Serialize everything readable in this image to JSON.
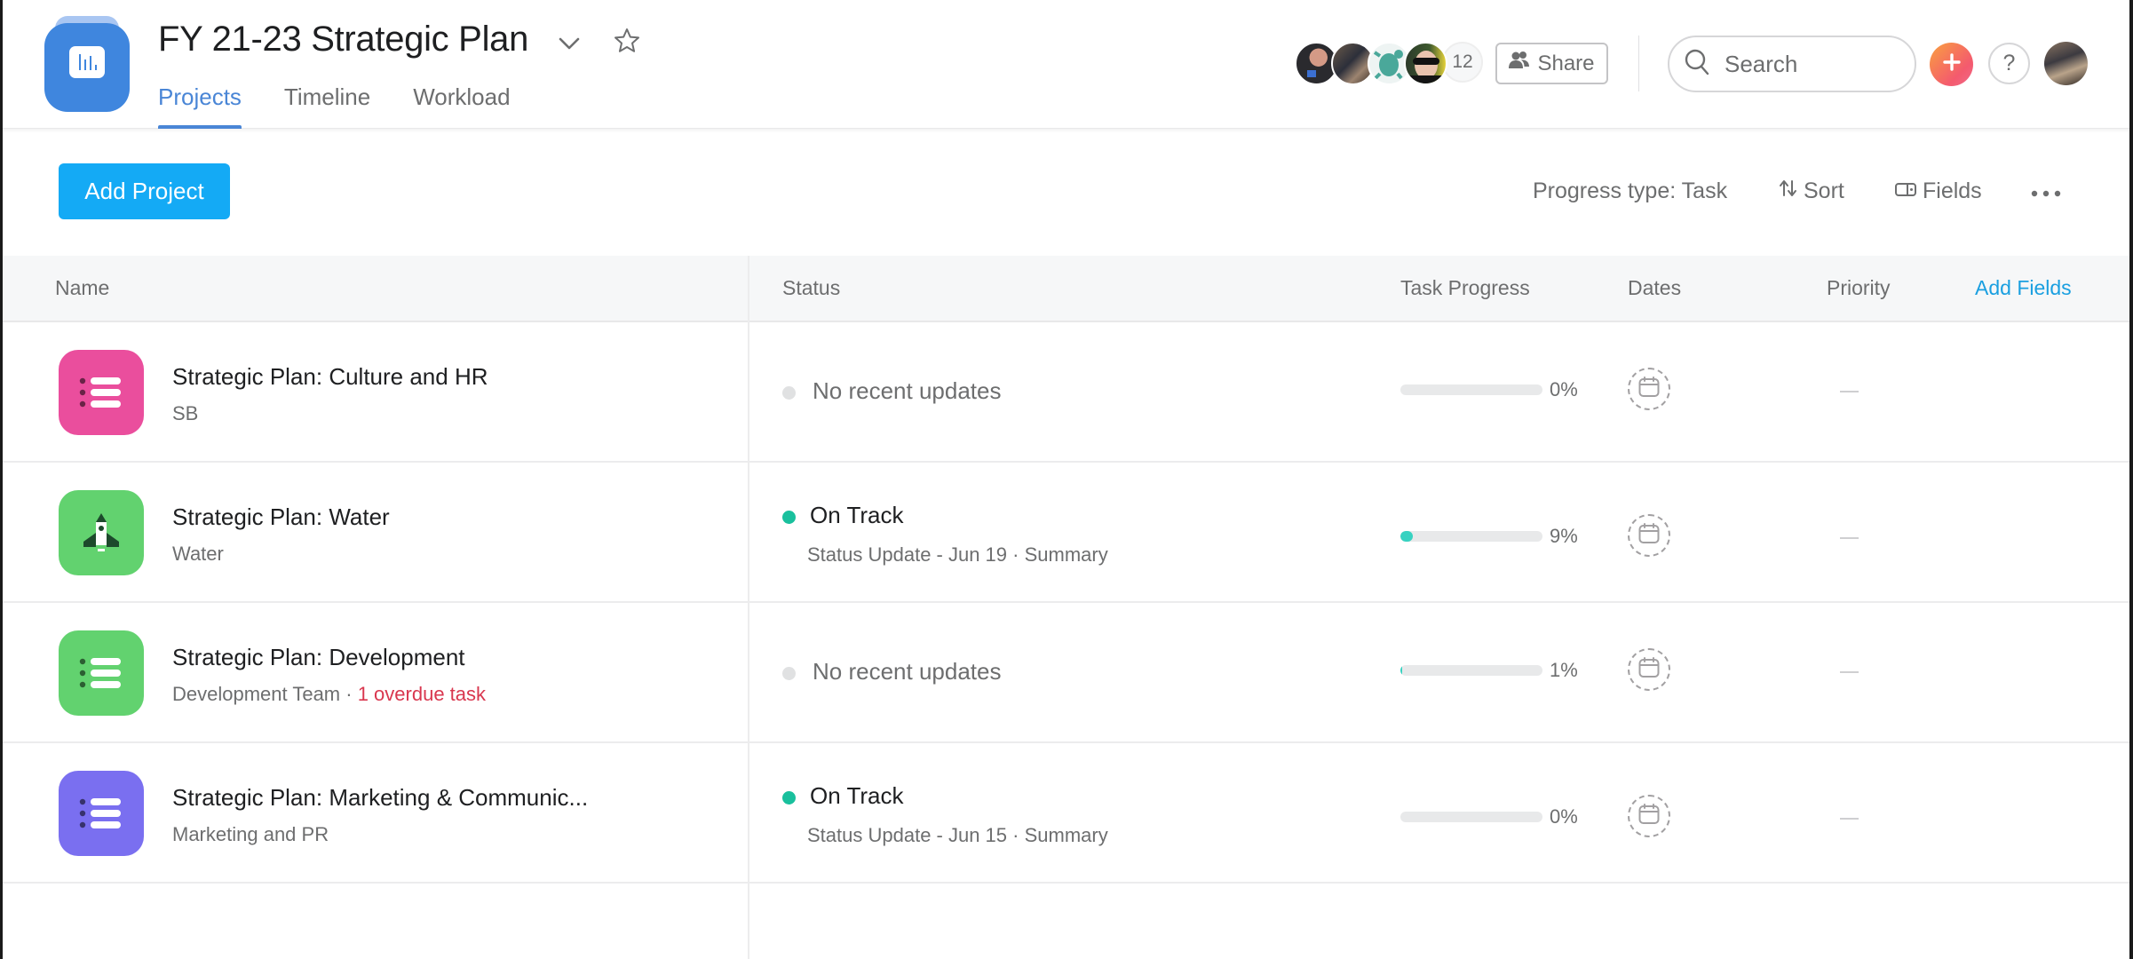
{
  "header": {
    "title": "FY 21-23 Strategic Plan",
    "logo_icon": "bar-chart-icon",
    "tabs": [
      {
        "label": "Projects",
        "active": true
      },
      {
        "label": "Timeline",
        "active": false
      },
      {
        "label": "Workload",
        "active": false
      }
    ],
    "members_count": "12",
    "share_label": "Share",
    "search_placeholder": "Search",
    "help_label": "?"
  },
  "toolbar": {
    "add_project_label": "Add Project",
    "progress_type_label": "Progress type: Task",
    "sort_label": "Sort",
    "fields_label": "Fields"
  },
  "table": {
    "columns": {
      "name": "Name",
      "status": "Status",
      "task_progress": "Task Progress",
      "dates": "Dates",
      "priority": "Priority",
      "add_fields": "Add Fields"
    },
    "rows": [
      {
        "title": "Strategic Plan: Culture and HR",
        "team": "SB",
        "overdue": "",
        "icon": "list-icon",
        "icon_color": "#ea4e9d",
        "status": "No recent updates",
        "status_color": "#e0e1e2",
        "status_detail": "",
        "progress_percent": 0,
        "progress_label": "0%",
        "priority": "—"
      },
      {
        "title": "Strategic Plan: Water",
        "team": "Water",
        "overdue": "",
        "icon": "rocket-icon",
        "icon_color": "#62d26f",
        "status": "On Track",
        "status_color": "#19c09d",
        "status_detail": "Status Update - Jun 19 · Summary",
        "progress_percent": 9,
        "progress_label": "9%",
        "priority": "—"
      },
      {
        "title": "Strategic Plan: Development",
        "team": "Development Team",
        "overdue": "1 overdue task",
        "icon": "list-icon",
        "icon_color": "#62d26f",
        "status": "No recent updates",
        "status_color": "#e0e1e2",
        "status_detail": "",
        "progress_percent": 1,
        "progress_label": "1%",
        "priority": "—"
      },
      {
        "title": "Strategic Plan: Marketing & Communic...",
        "team": "Marketing and PR",
        "overdue": "",
        "icon": "list-icon",
        "icon_color": "#7a6ff0",
        "status": "On Track",
        "status_color": "#19c09d",
        "status_detail": "Status Update - Jun 15 · Summary",
        "progress_percent": 0,
        "progress_label": "0%",
        "priority": "—"
      }
    ]
  },
  "colors": {
    "accent": "#4a86d6",
    "primary_button": "#14aaf5",
    "on_track": "#19c09d",
    "progress_fill": "#37d2c1",
    "overdue": "#d9374f"
  }
}
